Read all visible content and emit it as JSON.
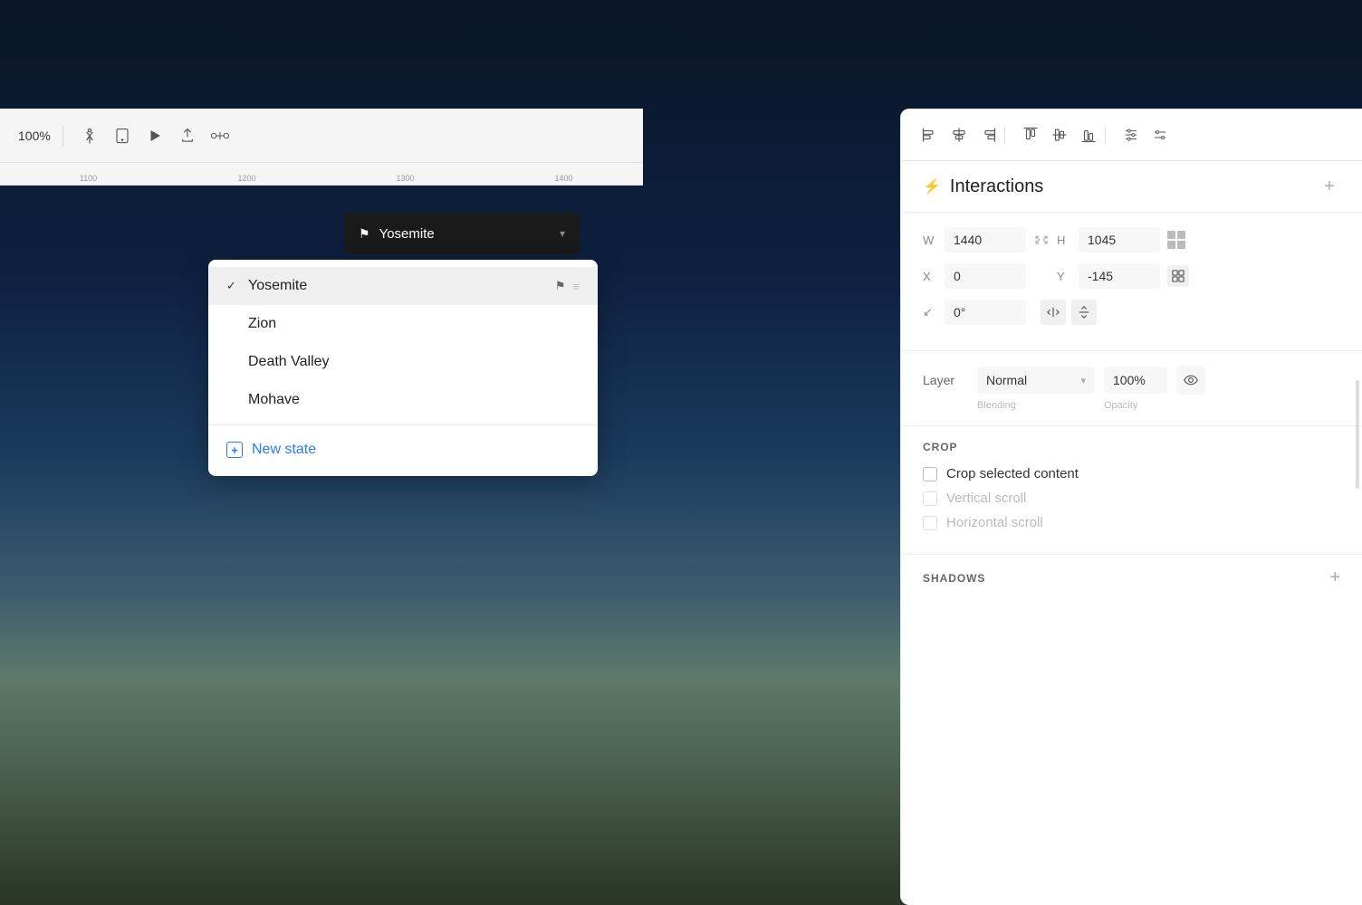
{
  "background": {
    "gradient": "night_mountains"
  },
  "toolbar": {
    "zoom": "100%",
    "icons": [
      "accessibility",
      "tablet",
      "play",
      "export",
      "connections"
    ]
  },
  "ruler": {
    "marks": [
      "1100",
      "1200",
      "1300",
      "1400"
    ]
  },
  "state_button": {
    "label": "Yosemite",
    "flag": "⚑"
  },
  "dropdown": {
    "items": [
      {
        "label": "Yosemite",
        "selected": true,
        "has_flag": true
      },
      {
        "label": "Zion",
        "selected": false,
        "has_flag": false
      },
      {
        "label": "Death Valley",
        "selected": false,
        "has_flag": false
      },
      {
        "label": "Mohave",
        "selected": false,
        "has_flag": false
      }
    ],
    "new_state_label": "New state"
  },
  "right_panel": {
    "toolbar_icons": [
      "align-left",
      "align-center-h",
      "align-right",
      "align-top",
      "align-center-v",
      "align-bottom",
      "adjust",
      "sliders"
    ],
    "interactions": {
      "title": "Interactions",
      "add_label": "+"
    },
    "properties": {
      "w_label": "W",
      "w_value": "1440",
      "h_label": "H",
      "h_value": "1045",
      "x_label": "X",
      "x_value": "0",
      "y_label": "Y",
      "y_value": "-145",
      "rotation_label": "↙",
      "rotation_value": "0°"
    },
    "layer": {
      "label": "Layer",
      "blend_mode": "Normal",
      "opacity": "100%",
      "blend_sublabel": "Blending",
      "opacity_sublabel": "Opacity"
    },
    "crop": {
      "title": "CROP",
      "options": [
        {
          "label": "Crop selected content",
          "checked": false,
          "disabled": false
        },
        {
          "label": "Vertical scroll",
          "checked": false,
          "disabled": true
        },
        {
          "label": "Horizontal scroll",
          "checked": false,
          "disabled": true
        }
      ]
    },
    "shadows": {
      "title": "SHADOWS",
      "add_label": "+"
    }
  }
}
